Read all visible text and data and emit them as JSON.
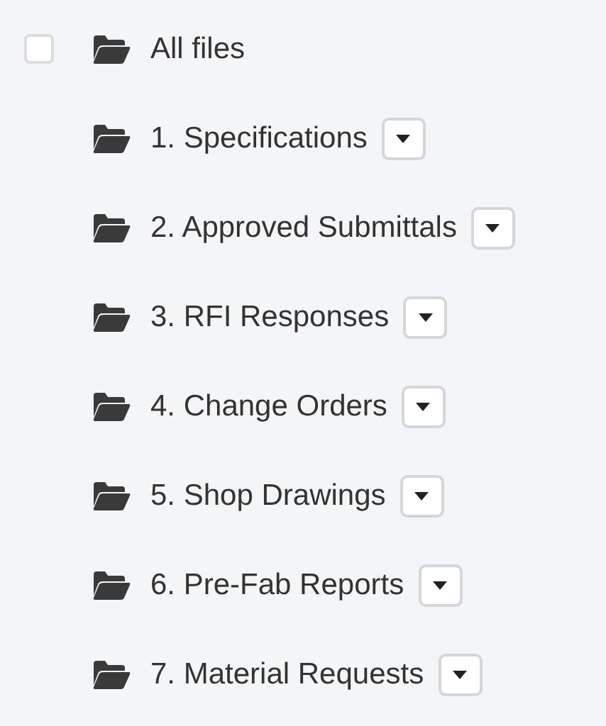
{
  "root": {
    "label": "All files",
    "checked": false,
    "children": [
      {
        "label": "1. Specifications"
      },
      {
        "label": "2. Approved Submittals"
      },
      {
        "label": "3. RFI Responses"
      },
      {
        "label": "4. Change Orders"
      },
      {
        "label": "5. Shop Drawings"
      },
      {
        "label": "6. Pre-Fab Reports"
      },
      {
        "label": "7. Material Requests"
      }
    ]
  }
}
